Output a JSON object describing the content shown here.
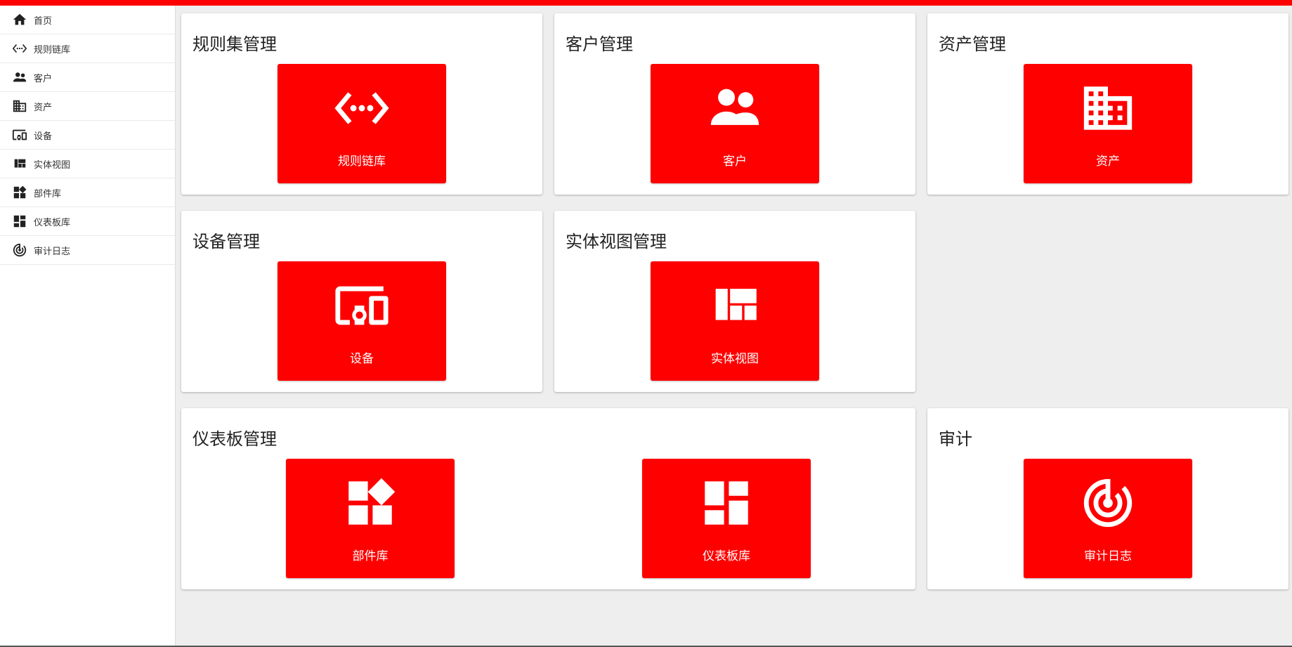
{
  "theme": {
    "accent": "#ff0000",
    "tile_text": "#ffffff",
    "background": "#eeeeee"
  },
  "sidebar": {
    "items": [
      {
        "label": "首页",
        "icon": "home-icon"
      },
      {
        "label": "规则链库",
        "icon": "code-brackets-icon"
      },
      {
        "label": "客户",
        "icon": "people-icon"
      },
      {
        "label": "资产",
        "icon": "building-icon"
      },
      {
        "label": "设备",
        "icon": "devices-icon"
      },
      {
        "label": "实体视图",
        "icon": "view-quilt-icon"
      },
      {
        "label": "部件库",
        "icon": "widgets-icon"
      },
      {
        "label": "仪表板库",
        "icon": "dashboard-icon"
      },
      {
        "label": "审计日志",
        "icon": "track-changes-icon"
      }
    ]
  },
  "cards": {
    "rulechains": {
      "title": "规则集管理",
      "tiles": [
        {
          "label": "规则链库",
          "icon": "code-brackets-icon"
        }
      ]
    },
    "customers": {
      "title": "客户管理",
      "tiles": [
        {
          "label": "客户",
          "icon": "people-icon"
        }
      ]
    },
    "assets": {
      "title": "资产管理",
      "tiles": [
        {
          "label": "资产",
          "icon": "building-icon"
        }
      ]
    },
    "devices": {
      "title": "设备管理",
      "tiles": [
        {
          "label": "设备",
          "icon": "devices-icon"
        }
      ]
    },
    "entity_views": {
      "title": "实体视图管理",
      "tiles": [
        {
          "label": "实体视图",
          "icon": "view-quilt-icon"
        }
      ]
    },
    "dashboards": {
      "title": "仪表板管理",
      "tiles": [
        {
          "label": "部件库",
          "icon": "widgets-icon"
        },
        {
          "label": "仪表板库",
          "icon": "dashboard-icon"
        }
      ]
    },
    "audit": {
      "title": "审计",
      "tiles": [
        {
          "label": "审计日志",
          "icon": "track-changes-icon"
        }
      ]
    }
  }
}
